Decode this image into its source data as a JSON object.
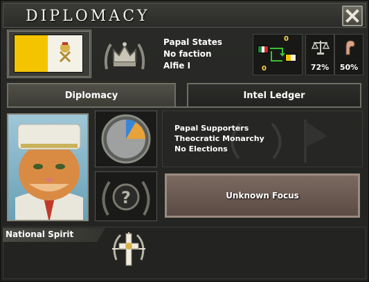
{
  "window": {
    "title": "Diplomacy"
  },
  "country": {
    "name": "Papal States",
    "faction": "No faction",
    "leader": "Alfie I"
  },
  "faction_panel": {
    "top_value": "0",
    "bottom_value": "0"
  },
  "stats": {
    "stability": "72%",
    "war_support": "50%"
  },
  "tabs": [
    {
      "label": "Diplomacy",
      "active": true
    },
    {
      "label": "Intel Ledger",
      "active": false
    }
  ],
  "ideology": {
    "party": "Papal Supporters",
    "government": "Theocratic Monarchy",
    "elections": "No Elections"
  },
  "focus": {
    "label": "Unknown Focus"
  },
  "national_spirit": {
    "label": "National Spirit"
  },
  "colors": {
    "flag_yellow": "#f4c400",
    "flag_white": "#f4f1e6",
    "value_yellow": "#ffd84a",
    "pie_blue": "#3a86d6",
    "pie_orange": "#e8a23a"
  },
  "icons": [
    "close-icon",
    "crown-emblem-icon",
    "scales-icon",
    "arm-icon",
    "question-icon",
    "cross-spirit-icon"
  ]
}
